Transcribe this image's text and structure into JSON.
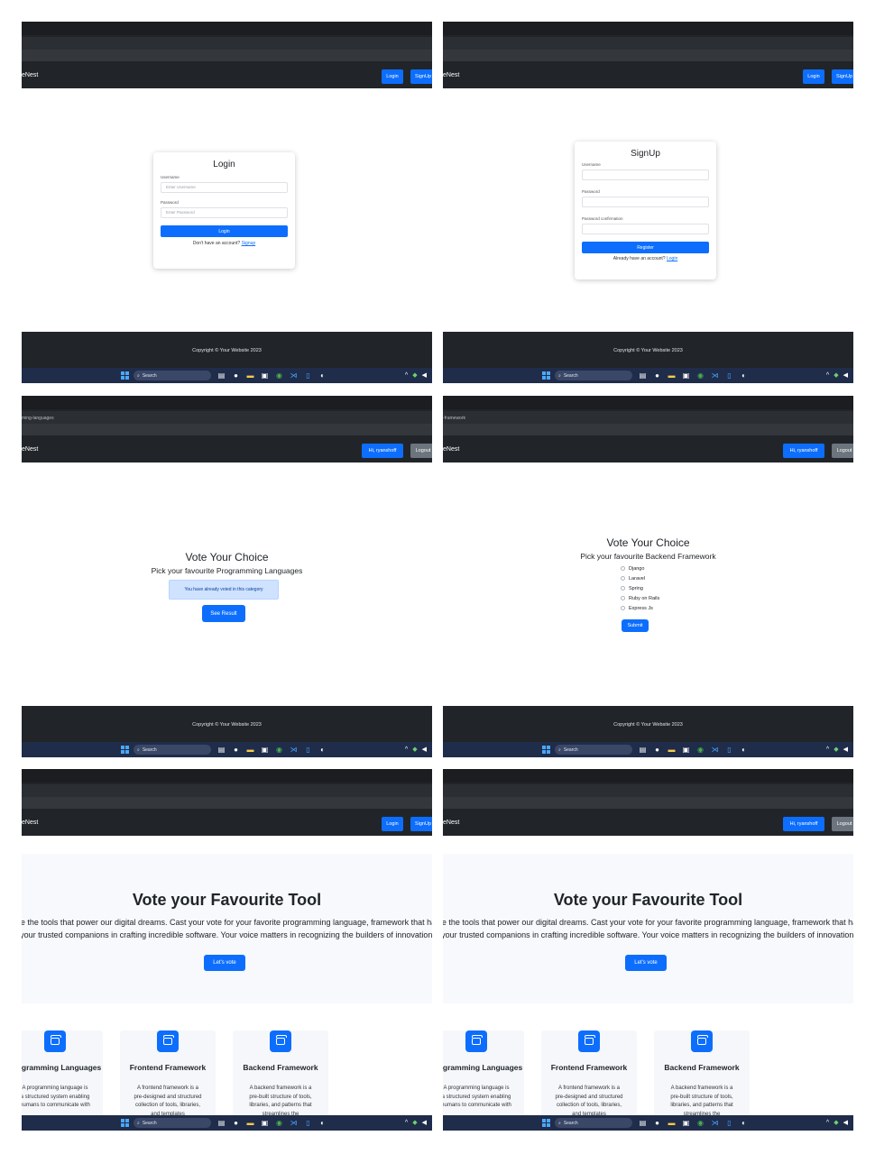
{
  "common": {
    "brand": "eNest",
    "footer_text": "Copyright © Your Website 2023",
    "taskbar": {
      "search_placeholder": "Search",
      "search_icon": "search-icon",
      "app_icons": [
        "file-explorer-icon",
        "chat-icon",
        "folder-icon",
        "store-icon",
        "chrome-icon",
        "vscode-icon",
        "notepad-icon",
        "github-icon"
      ],
      "tray_icons": [
        "chevron-up-icon",
        "wifi-icon",
        "speaker-icon"
      ]
    },
    "colors": {
      "primary": "#0d6efd",
      "navbar": "#212529",
      "taskbar": "#1f2c4a",
      "secondary": "#6c757d"
    }
  },
  "panels": {
    "login": {
      "nav": {
        "login": "Login",
        "signup": "SignUp"
      },
      "title": "Login",
      "username_label": "Username",
      "username_placeholder": "Enter Username",
      "password_label": "Password",
      "password_placeholder": "Enter Password",
      "submit": "Login",
      "note": "Don't have an account?",
      "note_link": "Signup"
    },
    "signup": {
      "nav": {
        "login": "Login",
        "signup": "SignUp"
      },
      "title": "SignUp",
      "username_label": "Username",
      "password_label": "Password",
      "confirm_label": "Password confirmation",
      "submit": "Register",
      "note": "Already have an account?",
      "note_link": "Login"
    },
    "voted": {
      "url": "ming-languages",
      "nav": {
        "user": "Hi, ryanshoff",
        "logout": "Logout"
      },
      "title": "Vote Your Choice",
      "subtitle": "Pick your favourite Programming Languages",
      "alert": "You have already voted in this category",
      "button": "See Result"
    },
    "backend": {
      "url": "-framework",
      "nav": {
        "user": "Hi, ryanshoff",
        "logout": "Logout"
      },
      "title": "Vote Your Choice",
      "subtitle": "Pick your favourite Backend Framework",
      "options": [
        "Django",
        "Laravel",
        "Spring",
        "Ruby on Rails",
        "Express Js"
      ],
      "button": "Submit"
    },
    "home_guest": {
      "nav": {
        "login": "Login",
        "signup": "SignUp"
      },
      "hero_title": "Vote your Favourite Tool",
      "hero_desc": "Celebrate the tools that power our digital dreams. Cast your vote for your favorite programming language, framework that have been your trusted companions in crafting incredible software. Your voice matters in recognizing the builders of innovation.",
      "cta": "Let's vote",
      "cards": [
        {
          "icon": "folder-icon",
          "name": "Programming Languages",
          "desc": "A programming language is a structured system enabling humans to communicate with"
        },
        {
          "icon": "folder-icon",
          "name": "Frontend Framework",
          "desc": "A frontend framework is a pre-designed and structured collection of tools, libraries, and templates"
        },
        {
          "icon": "folder-icon",
          "name": "Backend Framework",
          "desc": "A backend framework is a pre-built structure of tools, libraries, and patterns that streamlines the"
        }
      ]
    },
    "home_user": {
      "nav": {
        "user": "Hi, ryanshoff",
        "logout": "Logout"
      },
      "hero_title": "Vote your Favourite Tool",
      "hero_desc": "Celebrate the tools that power our digital dreams. Cast your vote for your favorite programming language, framework that have been your trusted companions in crafting incredible software. Your voice matters in recognizing the builders of innovation.",
      "cta": "Let's vote",
      "cards": [
        {
          "icon": "folder-icon",
          "name": "Programming Languages",
          "desc": "A programming language is a structured system enabling humans to communicate with"
        },
        {
          "icon": "folder-icon",
          "name": "Frontend Framework",
          "desc": "A frontend framework is a pre-designed and structured collection of tools, libraries, and templates"
        },
        {
          "icon": "folder-icon",
          "name": "Backend Framework",
          "desc": "A backend framework is a pre-built structure of tools, libraries, and patterns that streamlines the"
        }
      ]
    }
  }
}
